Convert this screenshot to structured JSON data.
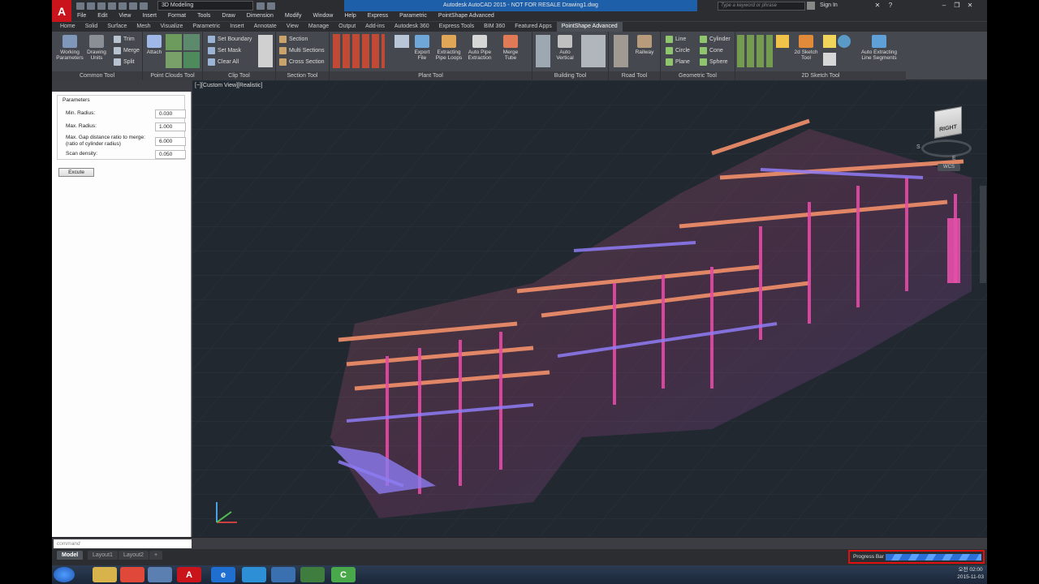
{
  "titlebar": {
    "logo": "A",
    "workspace": "3D Modeling",
    "app_title": "Autodesk AutoCAD 2015 - NOT FOR RESALE    Drawing1.dwg",
    "search_placeholder": "Type a keyword or phrase",
    "signin": "Sign In"
  },
  "menu": [
    "File",
    "Edit",
    "View",
    "Insert",
    "Format",
    "Tools",
    "Draw",
    "Dimension",
    "Modify",
    "Window",
    "Help",
    "Express",
    "Parametric",
    "PointShape Advanced"
  ],
  "ribbon_tabs": [
    "Home",
    "Solid",
    "Surface",
    "Mesh",
    "Visualize",
    "Parametric",
    "Insert",
    "Annotate",
    "View",
    "Manage",
    "Output",
    "Add-ins",
    "Autodesk 360",
    "Express Tools",
    "BIM 360",
    "Featured Apps",
    "PointShape Advanced"
  ],
  "active_tab_index": 16,
  "ribbon": {
    "common": {
      "title": "Common Tool",
      "working": "Working Parameters",
      "drawing": "Drawing Units",
      "trim": "Trim",
      "merge": "Merge",
      "split": "Split"
    },
    "pointclouds": {
      "title": "Point Clouds Tool",
      "attach": "Attach"
    },
    "clip": {
      "title": "Clip Tool",
      "set_boundary": "Set Boundary",
      "set_mask": "Set Mask",
      "clear_all": "Clear All"
    },
    "section": {
      "title": "Section Tool",
      "section": "Section",
      "multi": "Multi Sections",
      "cross": "Cross Section"
    },
    "plant": {
      "title": "Plant Tool",
      "export": "Export File",
      "extracting": "Extracting Pipe Loops",
      "auto_pipe": "Auto Pipe Extraction",
      "merge_tube": "Merge Tube"
    },
    "building": {
      "title": "Building Tool",
      "auto_vertical": "Auto Vertical"
    },
    "road": {
      "title": "Road Tool",
      "railway": "Railway"
    },
    "geometric": {
      "title": "Geometric Tool",
      "line": "Line",
      "circle": "Circle",
      "plane": "Plane",
      "cylinder": "Cylinder",
      "cone": "Cone",
      "sphere": "Sphere"
    },
    "sketch2d": {
      "title": "2D Sketch Tool",
      "sketch": "2d Sketch Tool",
      "auto_extract": "Auto Extracting Line Segments"
    }
  },
  "palette": {
    "group": "Parameters",
    "min_radius_label": "Min. Radius:",
    "min_radius": "0.030",
    "max_radius_label": "Max. Radius:",
    "max_radius": "1.000",
    "gap_label_1": "Max. Gap distance ratio to merge:",
    "gap_label_2": "(ratio of cylinder radius)",
    "gap": "6.000",
    "scan_label": "Scan density:",
    "scan": "0.050",
    "execute": "Excute"
  },
  "viewport": {
    "label": "[−][Custom View][Realistic]",
    "viewcube_face": "RIGHT",
    "wcs": "WCS",
    "compass_s": "S",
    "compass_e": "E"
  },
  "command": {
    "placeholder": "command"
  },
  "layouts": [
    "Model",
    "Layout1",
    "Layout2",
    "+"
  ],
  "progress": {
    "label": "Progress Bar",
    "value": 1.0
  },
  "clock": {
    "ampm": "오전 02:00",
    "date": "2015-11-03"
  }
}
